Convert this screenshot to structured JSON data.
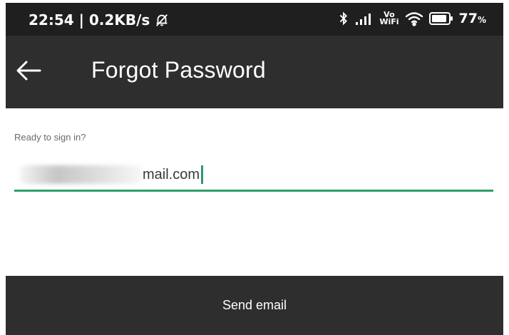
{
  "status_bar": {
    "time_speed": "22:54 | 0.2KB/s",
    "vo_wifi_top": "Vo",
    "vo_wifi_bottom": "WiFi",
    "battery": "77",
    "battery_unit": "%",
    "icons": [
      "bell-off-icon",
      "bluetooth-icon",
      "signal-icon",
      "wifi-icon",
      "battery-icon"
    ]
  },
  "app_bar": {
    "title": "Forgot Password",
    "back_icon": "back-arrow-icon"
  },
  "form": {
    "label": "Ready to sign in?",
    "email_value": "mail.com",
    "accent_color": "#2f9e6c"
  },
  "actions": {
    "send_label": "Send email"
  },
  "colors": {
    "status_bar_bg": "#1f1f1f",
    "app_bar_bg": "#2e2e2e",
    "button_bg": "#2e2e2e"
  }
}
